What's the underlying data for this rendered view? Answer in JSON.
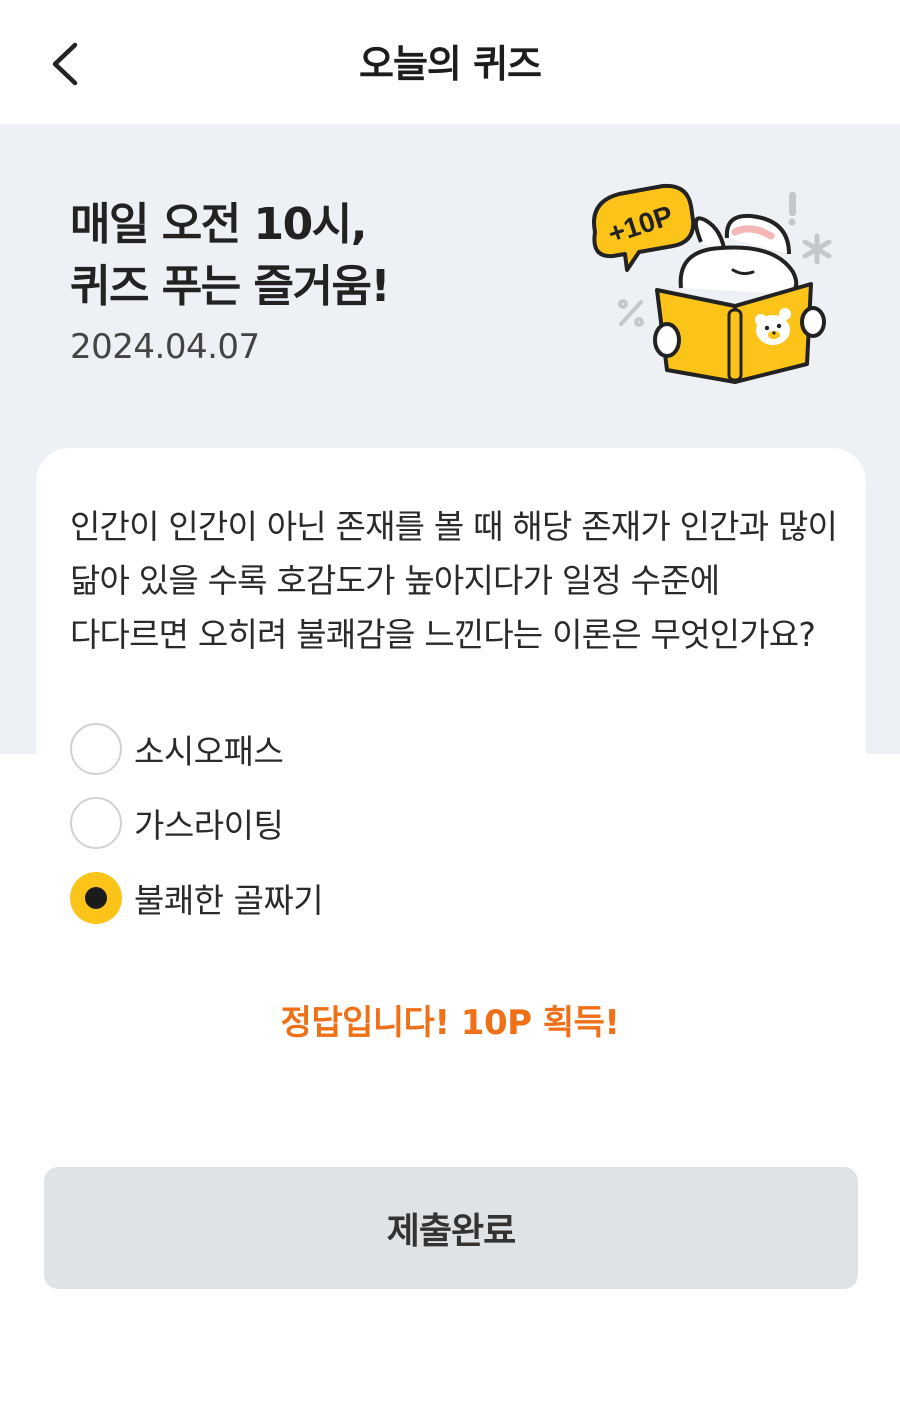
{
  "header": {
    "back_icon": "chevron-left-icon",
    "title": "오늘의 퀴즈"
  },
  "hero": {
    "title_line1": "매일 오전 10시,",
    "title_line2": "퀴즈 푸는 즐거움!",
    "date": "2024.04.07",
    "badge": "+10P",
    "mascot_icon": "rabbit-reading-book-icon"
  },
  "quiz": {
    "question": "인간이 인간이 아닌 존재를 볼 때 해당 존재가 인간과 많이 닮아 있을 수록 호감도가 높아지다가 일정 수준에 다다르면 오히려 불쾌감을 느낀다는 이론은 무엇인가요?",
    "options": [
      {
        "label": "소시오패스",
        "selected": false
      },
      {
        "label": "가스라이팅",
        "selected": false
      },
      {
        "label": "불쾌한 골짜기",
        "selected": true
      }
    ],
    "result": "정답입니다! 10P 획득!"
  },
  "submit": {
    "label": "제출완료"
  },
  "colors": {
    "accent": "#fcc419",
    "result_text": "#f07018",
    "hero_bg": "#edf1f5",
    "button_bg": "#dfe3e6"
  }
}
